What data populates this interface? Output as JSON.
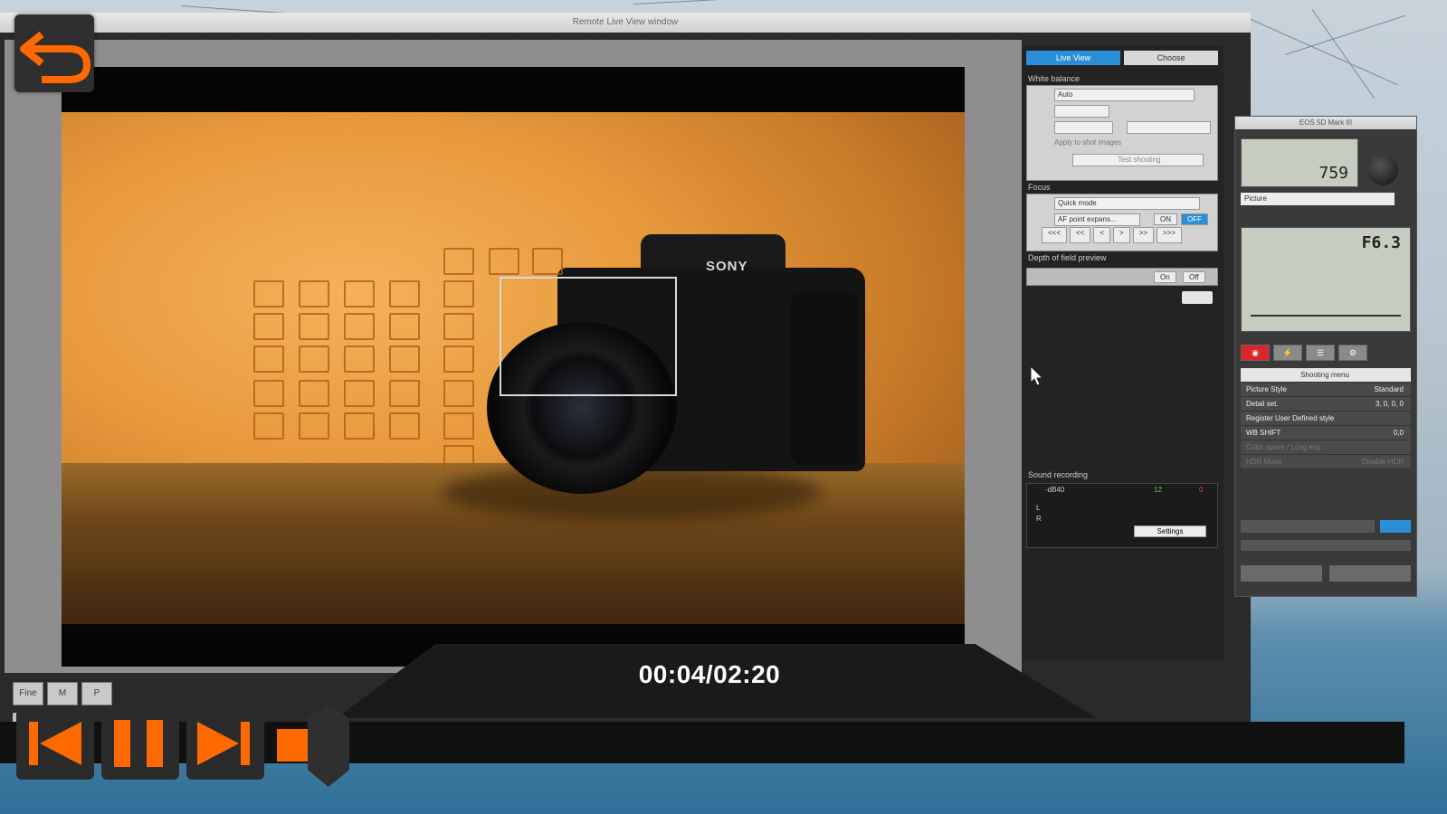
{
  "window": {
    "title": "Remote Live View window"
  },
  "right_panel": {
    "tabs": [
      {
        "label": "Live View",
        "active": true
      },
      {
        "label": "Choose",
        "active": false
      }
    ],
    "white_balance": {
      "title": "White balance",
      "mode": "Auto",
      "apply_label": "Apply to shot images",
      "test_shooting": "Test shooting"
    },
    "focus": {
      "title": "Focus",
      "mode": "Quick mode",
      "af_point": "AF point expans...",
      "on_label": "ON",
      "off_label": "OFF"
    },
    "depth_of_field": {
      "title": "Depth of field preview",
      "on_label": "On",
      "off_label": "Off"
    },
    "sound_recording": {
      "title": "Sound recording",
      "db_label": "-dB40",
      "mid_label": "12",
      "end_label": "0",
      "l_label": "L",
      "r_label": "R",
      "settings_button": "Settings"
    }
  },
  "camera_window": {
    "title": "EOS 5D Mark III",
    "shots_remaining": "759",
    "mode": "Picture",
    "aperture": "F6.3",
    "shooting_menu": {
      "header": "Shooting menu",
      "rows": [
        {
          "label": "Picture Style",
          "value": "Standard"
        },
        {
          "label": "Detail set.",
          "value": "3, 0, 0, 0"
        },
        {
          "label": "Register User Defined style",
          "value": ""
        },
        {
          "label": "WB SHIFT",
          "value": "0,0"
        },
        {
          "label": "Color space / Long exp.",
          "value": ""
        },
        {
          "label": "HDR Mode",
          "value": "Disable HDR"
        }
      ]
    }
  },
  "thumbnails": [
    "Fine",
    "M",
    "P"
  ],
  "player": {
    "timecode": "00:04/02:20",
    "progress_fraction": 0.029
  },
  "icons": {
    "back": "back-arrow-icon",
    "previous": "skip-previous-icon",
    "pause": "pause-icon",
    "next": "skip-next-icon",
    "cursor": "mouse-pointer-icon"
  },
  "colors": {
    "accent": "#ff6a00",
    "tab_active": "#2a8fd6",
    "record": "#d9262b"
  }
}
